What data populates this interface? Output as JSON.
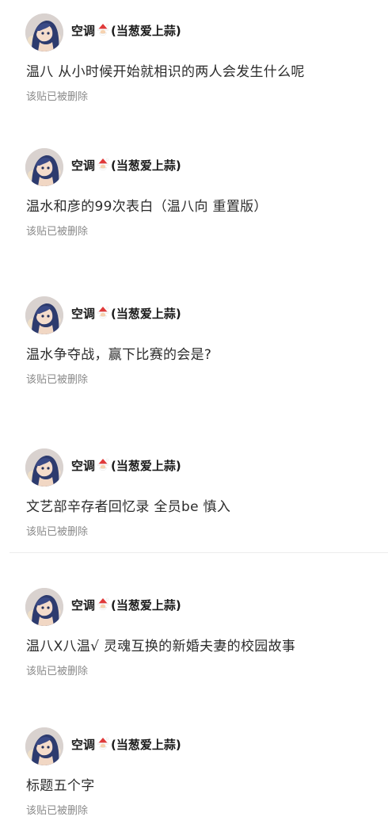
{
  "posts": [
    {
      "author": "空调",
      "author_suffix": "(当葱爱上蒜)",
      "title": "温八  从小时候开始就相识的两人会发生什么呢",
      "status": "该贴已被删除"
    },
    {
      "author": "空调",
      "author_suffix": "(当葱爱上蒜)",
      "title": "温水和彦的99次表白（温八向 重置版）",
      "status": "该贴已被删除"
    },
    {
      "author": "空调",
      "author_suffix": "(当葱爱上蒜)",
      "title": "温水争夺战，赢下比赛的会是?",
      "status": "该贴已被删除"
    },
    {
      "author": "空调",
      "author_suffix": "(当葱爱上蒜)",
      "title": "文艺部辛存者回忆录 全员be 慎入",
      "status": "该贴已被删除"
    },
    {
      "author": "空调",
      "author_suffix": "(当葱爱上蒜)",
      "title": "温八X八温√ 灵魂互换的新婚夫妻的校园故事",
      "status": "该贴已被删除"
    },
    {
      "author": "空调",
      "author_suffix": "(当葱爱上蒜)",
      "title": "标题五个字",
      "status": "该贴已被删除"
    }
  ],
  "icons": {
    "avatar": "anime-avatar-icon",
    "name_emoji": "santa-icon"
  },
  "colors": {
    "background": "#ffffff",
    "username": "#1a1a1a",
    "title": "#2b2b2b",
    "status": "#8a8a8a",
    "divider": "#ececec"
  }
}
